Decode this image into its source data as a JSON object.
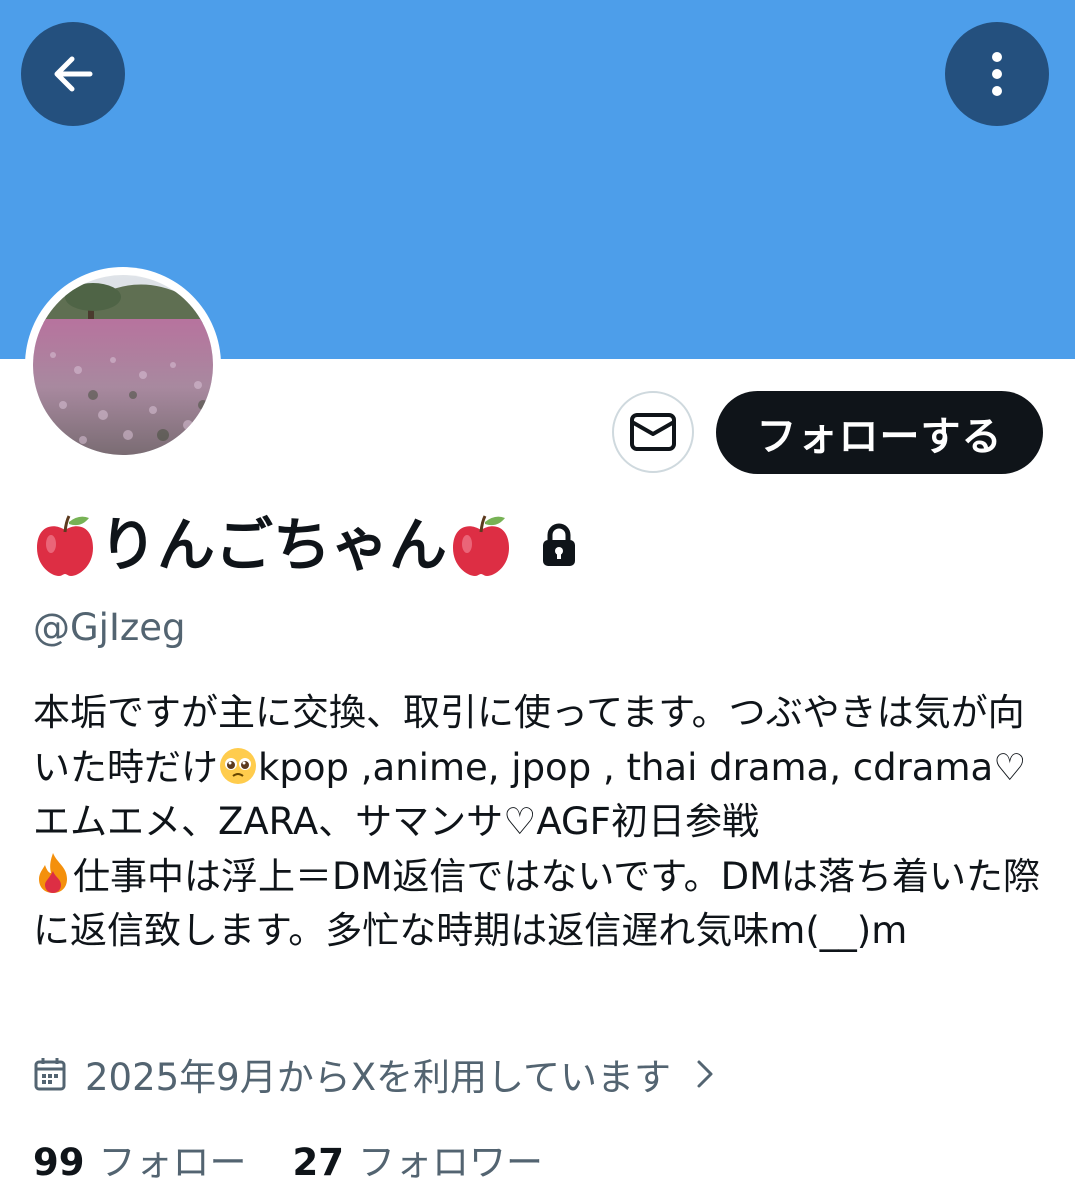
{
  "header": {
    "back_icon": "arrow-left-icon",
    "more_icon": "more-vertical-icon",
    "banner_color": "#4d9eea"
  },
  "actions": {
    "message_icon": "mail-icon",
    "follow_label": "フォローする"
  },
  "profile": {
    "display_name": "りんごちゃん",
    "name_prefix_emoji": "apple-icon",
    "name_suffix_emoji": "apple-icon",
    "protected_icon": "lock-icon",
    "handle": "@GjIzeg",
    "bio": {
      "part1": "本垢ですが主に交換、取引に使ってます。つぶやきは気が向いた時だけ",
      "emoji1": "pleading-face-icon",
      "part2": "kpop ,anime, jpop , thai drama, cdrama♡エムエメ、ZARA、サマンサ♡AGF初日参戦",
      "emoji2": "fire-icon",
      "part3": "仕事中は浮上＝DM返信ではないです。DMは落ち着いた際に返信致します。多忙な時期は返信遅れ気味m(__)m"
    },
    "joined": "2025年9月からXを利用しています",
    "following_count": "99",
    "following_label": "フォロー",
    "followers_count": "27",
    "followers_label": "フォロワー"
  }
}
